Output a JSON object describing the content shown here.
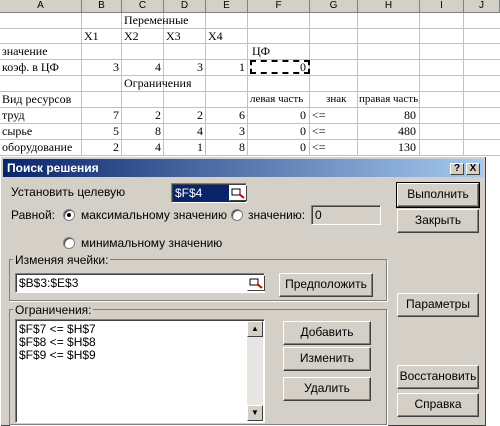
{
  "sheet": {
    "columns": [
      "A",
      "B",
      "C",
      "D",
      "E",
      "F",
      "G",
      "H",
      "I",
      "J"
    ],
    "rows": [
      {
        "label": "",
        "cells": [
          "",
          "",
          "Переменные",
          "",
          "",
          "",
          "",
          "",
          ""
        ]
      },
      {
        "label": "",
        "cells": [
          "",
          "X1",
          "X2",
          "X3",
          "X4",
          "",
          "",
          "",
          ""
        ]
      },
      {
        "label": "значение",
        "cells": [
          "",
          "",
          "",
          "",
          "ЦФ",
          "",
          "",
          ""
        ]
      },
      {
        "label": "коэф. в ЦФ",
        "cells": [
          "3",
          "4",
          "3",
          "1",
          "0",
          "",
          "",
          ""
        ]
      },
      {
        "label": "",
        "cells": [
          "",
          "Ограничения",
          "",
          "",
          "",
          "",
          "",
          ""
        ]
      },
      {
        "label": "Вид ресурсов",
        "cells": [
          "",
          "",
          "",
          "",
          "левая часть",
          "знак",
          "правая часть",
          ""
        ]
      },
      {
        "label": "труд",
        "cells": [
          "7",
          "2",
          "2",
          "6",
          "0",
          "<=",
          "80",
          ""
        ]
      },
      {
        "label": "сырье",
        "cells": [
          "5",
          "8",
          "4",
          "3",
          "0",
          "<=",
          "480",
          ""
        ]
      },
      {
        "label": "оборудование",
        "cells": [
          "2",
          "4",
          "1",
          "8",
          "0",
          "<=",
          "130",
          ""
        ]
      }
    ]
  },
  "dialog": {
    "title": "Поиск решения",
    "help_btn": "?",
    "close_btn": "X",
    "target_label": "Установить целевую",
    "target_value": "$F$4",
    "equal_label": "Равной:",
    "opt_max": "максимальному значению",
    "opt_value": "значению:",
    "value_field": "0",
    "opt_min": "минимальному значению",
    "changing_label": "Изменяя ячейки:",
    "changing_value": "$B$3:$E$3",
    "guess_btn": "Предположить",
    "constraints_label": "Ограничения:",
    "constraints": [
      "$F$7 <= $H$7",
      "$F$8 <= $H$8",
      "$F$9 <= $H$9"
    ],
    "add_btn": "Добавить",
    "change_btn": "Изменить",
    "delete_btn": "Удалить",
    "solve_btn": "Выполнить",
    "close_button": "Закрыть",
    "options_btn": "Параметры",
    "reset_btn": "Восстановить",
    "help_button": "Справка",
    "selected_option": "max"
  }
}
